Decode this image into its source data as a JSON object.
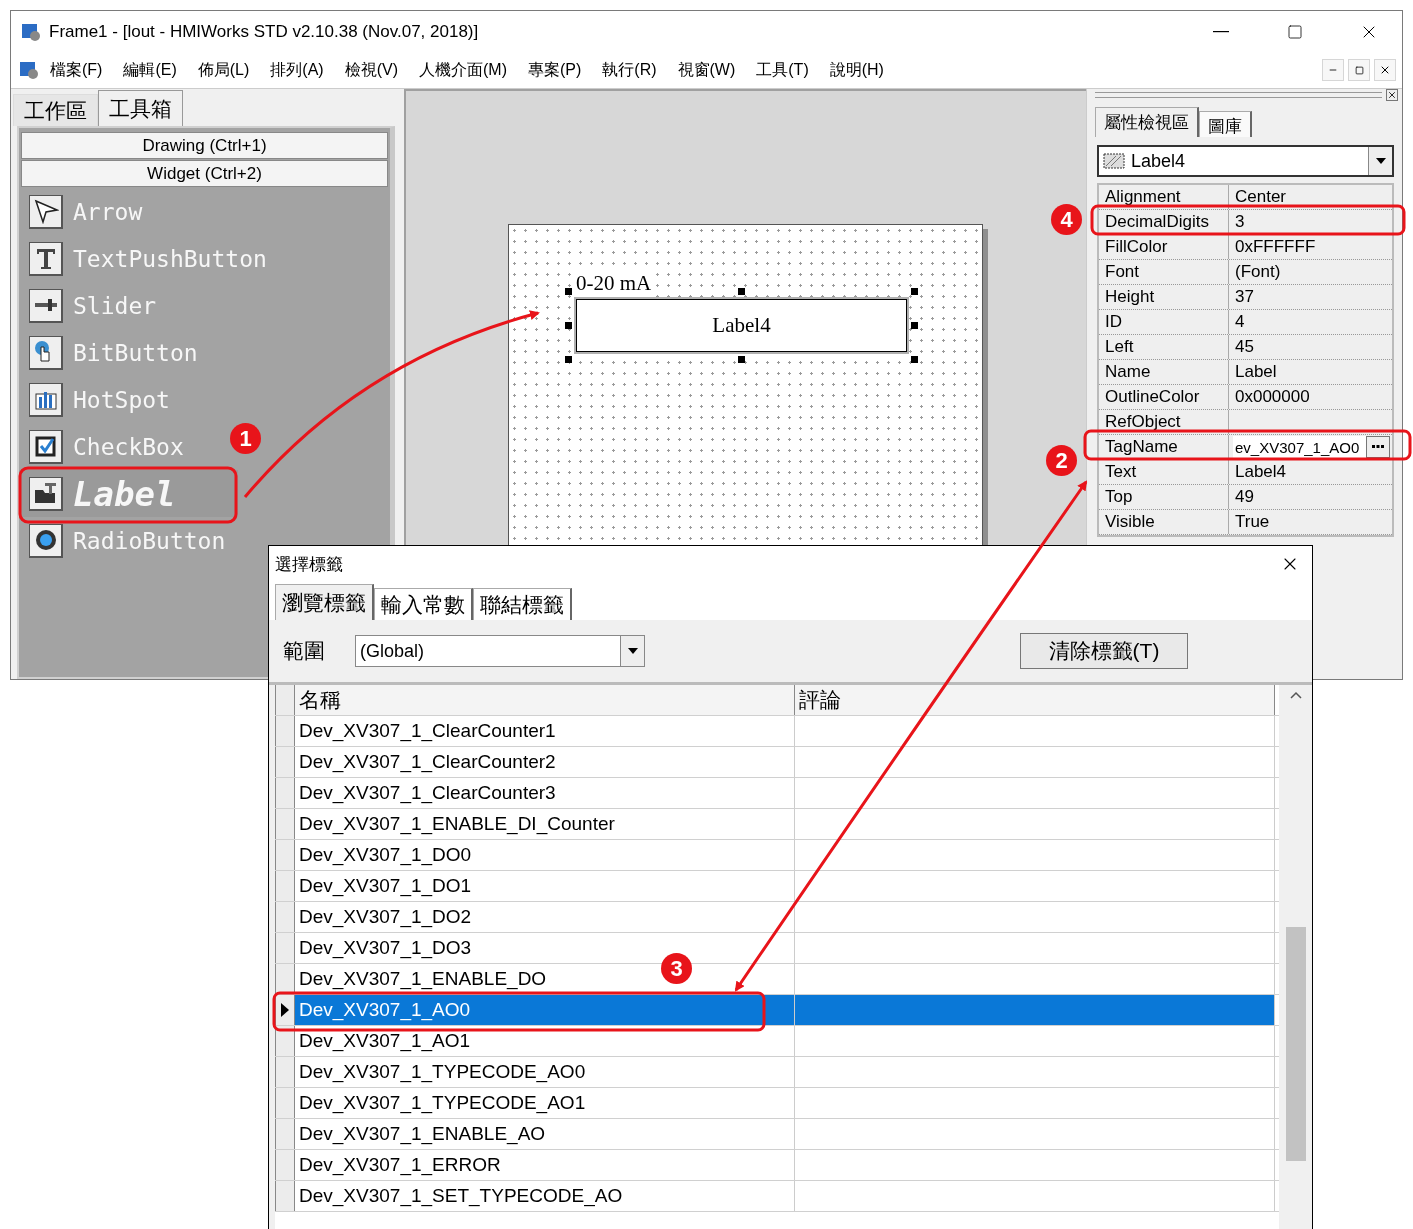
{
  "window": {
    "title": "Frame1 - [lout - HMIWorks STD v2.10.38 (Nov.07, 2018)]"
  },
  "menu": [
    "檔案(F)",
    "編輯(E)",
    "佈局(L)",
    "排列(A)",
    "檢視(V)",
    "人機介面(M)",
    "專案(P)",
    "執行(R)",
    "視窗(W)",
    "工具(T)",
    "說明(H)"
  ],
  "left_panel": {
    "tabs": [
      {
        "label": "工作區",
        "selected": false
      },
      {
        "label": "工具箱",
        "selected": true
      }
    ],
    "groups": [
      "Drawing (Ctrl+1)",
      "Widget (Ctrl+2)"
    ],
    "tools": [
      {
        "label": "Arrow",
        "selected": false
      },
      {
        "label": "TextPushButton",
        "selected": false
      },
      {
        "label": "Slider",
        "selected": false
      },
      {
        "label": "BitButton",
        "selected": false
      },
      {
        "label": "HotSpot",
        "selected": false
      },
      {
        "label": "CheckBox",
        "selected": false
      },
      {
        "label": "Label",
        "selected": true
      },
      {
        "label": "RadioButton",
        "selected": false
      }
    ]
  },
  "canvas": {
    "caption": "0-20 mA",
    "widget": {
      "text": "Label4",
      "selected": true
    }
  },
  "properties": {
    "tabs": [
      {
        "label": "屬性檢視區",
        "selected": true
      },
      {
        "label": "圖庫",
        "selected": false
      }
    ],
    "object": "Label4",
    "rows": [
      {
        "name": "Alignment",
        "value": "Center",
        "kind": "text"
      },
      {
        "name": "DecimalDigits",
        "value": "3",
        "kind": "text"
      },
      {
        "name": "FillColor",
        "value": "0xFFFFFF",
        "kind": "text"
      },
      {
        "name": "Font",
        "value": "(Font)",
        "kind": "text"
      },
      {
        "name": "Height",
        "value": "37",
        "kind": "text"
      },
      {
        "name": "ID",
        "value": "4",
        "kind": "text"
      },
      {
        "name": "Left",
        "value": "45",
        "kind": "text"
      },
      {
        "name": "Name",
        "value": "Label",
        "kind": "text"
      },
      {
        "name": "OutlineColor",
        "value": "0x000000",
        "kind": "text"
      },
      {
        "name": "RefObject",
        "kind": "text"
      },
      {
        "name": "TagName",
        "value": "ev_XV307_1_AO0",
        "kind": "picker"
      },
      {
        "name": "Text",
        "value": "Label4",
        "kind": "text"
      },
      {
        "name": "Top",
        "value": "49",
        "kind": "text"
      },
      {
        "name": "Visible",
        "value": "True",
        "kind": "text"
      }
    ]
  },
  "dialog": {
    "title": "選擇標籤",
    "tabs": [
      {
        "label": "瀏覽標籤",
        "selected": true
      },
      {
        "label": "輸入常數",
        "selected": false
      },
      {
        "label": "聯結標籤",
        "selected": false
      }
    ],
    "scope_label": "範圍",
    "scope": "(Global)",
    "clear_button": "清除標籤(T)",
    "columns": [
      "名稱",
      "評論"
    ],
    "rows": [
      {
        "name": "Dev_XV307_1_ClearCounter1",
        "selected": false
      },
      {
        "name": "Dev_XV307_1_ClearCounter2",
        "selected": false
      },
      {
        "name": "Dev_XV307_1_ClearCounter3",
        "selected": false
      },
      {
        "name": "Dev_XV307_1_ENABLE_DI_Counter",
        "selected": false
      },
      {
        "name": "Dev_XV307_1_DO0",
        "selected": false
      },
      {
        "name": "Dev_XV307_1_DO1",
        "selected": false
      },
      {
        "name": "Dev_XV307_1_DO2",
        "selected": false
      },
      {
        "name": "Dev_XV307_1_DO3",
        "selected": false
      },
      {
        "name": "Dev_XV307_1_ENABLE_DO",
        "selected": false
      },
      {
        "name": "Dev_XV307_1_AO0",
        "selected": true
      },
      {
        "name": "Dev_XV307_1_AO1",
        "selected": false
      },
      {
        "name": "Dev_XV307_1_TYPECODE_AO0",
        "selected": false
      },
      {
        "name": "Dev_XV307_1_TYPECODE_AO1",
        "selected": false
      },
      {
        "name": "Dev_XV307_1_ENABLE_AO",
        "selected": false
      },
      {
        "name": "Dev_XV307_1_ERROR",
        "selected": false
      },
      {
        "name": "Dev_XV307_1_SET_TYPECODE_AO",
        "selected": false
      }
    ]
  },
  "callouts": [
    {
      "number": "1"
    },
    {
      "number": "2"
    },
    {
      "number": "3"
    },
    {
      "number": "4"
    }
  ]
}
